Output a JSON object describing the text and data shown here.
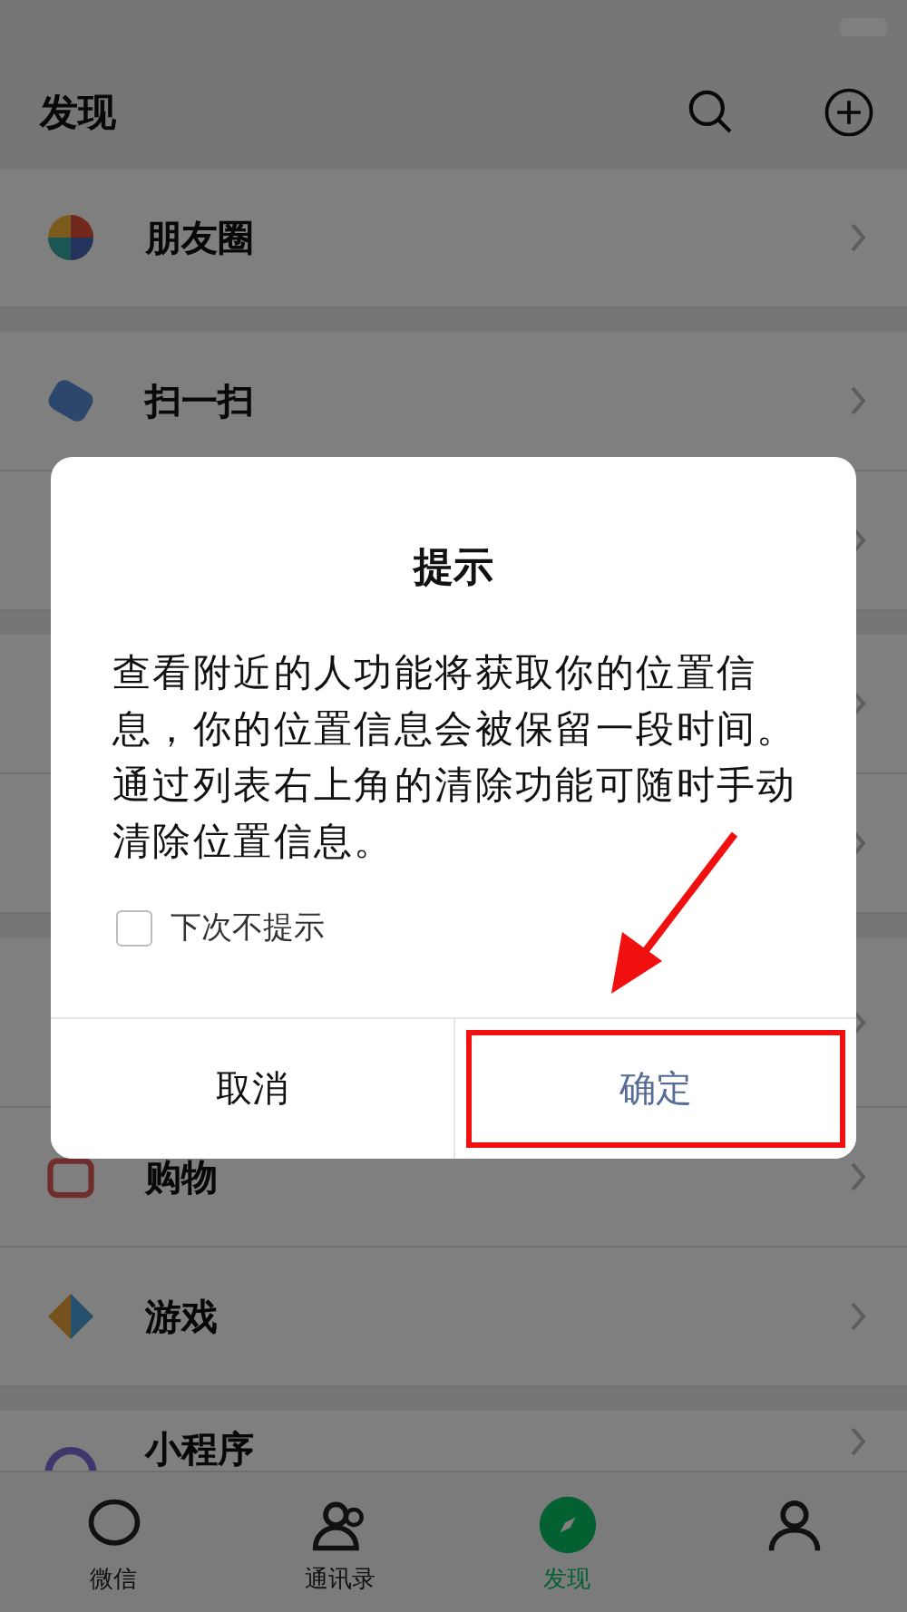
{
  "header": {
    "title": "发现"
  },
  "sections": [
    {
      "items": [
        {
          "kind": "entry",
          "label": "朋友圈"
        }
      ]
    },
    {
      "items": [
        {
          "kind": "entry",
          "label": "扫一扫"
        },
        {
          "kind": "covered"
        }
      ]
    },
    {
      "items": [
        {
          "kind": "covered"
        },
        {
          "kind": "covered"
        }
      ]
    },
    {
      "items": [
        {
          "kind": "covered"
        },
        {
          "kind": "entry",
          "label": "购物"
        },
        {
          "kind": "entry",
          "label": "游戏"
        }
      ]
    },
    {
      "items": [
        {
          "kind": "entry",
          "label": "小程序"
        }
      ]
    }
  ],
  "tabs": [
    {
      "label": "微信",
      "selected": false
    },
    {
      "label": "通讯录",
      "selected": false
    },
    {
      "label": "发现",
      "selected": true
    },
    {
      "selected": false
    }
  ],
  "dialog": {
    "title": "提示",
    "message": "查看附近的人功能将获取你的位置信息，你的位置信息会被保留一段时间。通过列表右上角的清除功能可随时手动清除位置信息。",
    "checkbox": {
      "label": "下次不提示",
      "checked": false
    },
    "buttons": [
      {
        "label": "取消",
        "kind": "cancel",
        "highlighted": false
      },
      {
        "label": "确定",
        "kind": "confirm",
        "highlighted": true
      }
    ]
  },
  "annotation_arrow": true
}
